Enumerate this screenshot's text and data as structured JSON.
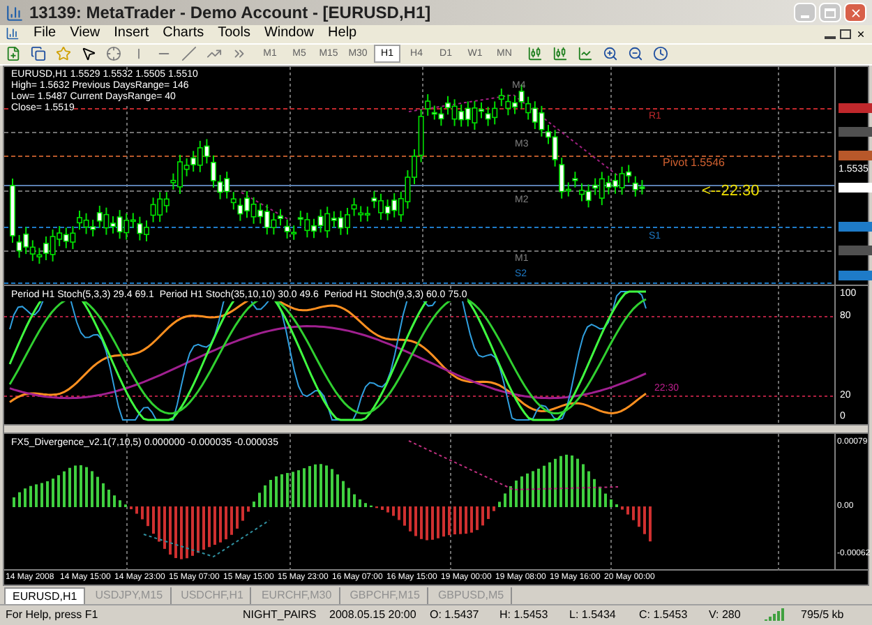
{
  "window": {
    "title": "13139: MetaTrader - Demo Account - [EURUSD,H1]"
  },
  "menu": [
    "File",
    "View",
    "Insert",
    "Charts",
    "Tools",
    "Window",
    "Help"
  ],
  "timeframes": [
    {
      "label": "M1",
      "selected": false
    },
    {
      "label": "M5",
      "selected": false
    },
    {
      "label": "M15",
      "selected": false
    },
    {
      "label": "M30",
      "selected": false
    },
    {
      "label": "H1",
      "selected": true
    },
    {
      "label": "H4",
      "selected": false
    },
    {
      "label": "D1",
      "selected": false
    },
    {
      "label": "W1",
      "selected": false
    },
    {
      "label": "MN",
      "selected": false
    }
  ],
  "main_chart": {
    "legend": [
      "EURUSD,H1  1.5529 1.5532 1.5505 1.5510",
      "High= 1.5632 Previous DaysRange= 146",
      "Low= 1.5487 Current DaysRange= 40",
      "Close= 1.5519"
    ],
    "levels": [
      {
        "label": "M4",
        "color": "#808080"
      },
      {
        "label": "R1",
        "color": "#c0282c"
      },
      {
        "label": "M3",
        "color": "#808080"
      },
      {
        "label": "M2",
        "color": "#808080"
      },
      {
        "label": "S1",
        "color": "#1e7bc8"
      },
      {
        "label": "M1",
        "color": "#808080"
      },
      {
        "label": "S2",
        "color": "#1e7bc8"
      }
    ],
    "pivot": "Pivot  1.5546",
    "countdown": "<--22:30",
    "price": "1.5535"
  },
  "stochastic": {
    "legend": [
      "Period H1 Stoch(5,3,3) 29.4 69.1",
      "Period H1 Stoch(35,10,10) 30.0 49.6",
      "Period H1 Stoch(9,3,3) 60.0 75.0"
    ],
    "axis": [
      "100",
      "80",
      "20",
      "0"
    ],
    "countdown": "22:30"
  },
  "divergence": {
    "legend": "FX5_Divergence_v2.1(7,10,5) 0.000000 -0.000035 -0.000035",
    "axis": [
      "0.00079",
      "0.00",
      "-0.00062"
    ]
  },
  "time_axis": [
    "14 May 2008",
    "14 May 15:00",
    "14 May 23:00",
    "15 May 07:00",
    "15 May 15:00",
    "15 May 23:00",
    "16 May 07:00",
    "16 May 15:00",
    "19 May 00:00",
    "19 May 08:00",
    "19 May 16:00",
    "20 May 00:00"
  ],
  "tabs": [
    {
      "label": "EURUSD,H1",
      "selected": true
    },
    {
      "label": "USDJPY,M15",
      "selected": false
    },
    {
      "label": "USDCHF,H1",
      "selected": false
    },
    {
      "label": "EURCHF,M30",
      "selected": false
    },
    {
      "label": "GBPCHF,M15",
      "selected": false
    },
    {
      "label": "GBPUSD,M5",
      "selected": false
    }
  ],
  "status_bar": [
    "For Help, press F1",
    "NIGHT_PAIRS",
    "2008.05.15 20:00",
    "O: 1.5437",
    "H: 1.5453",
    "L: 1.5434",
    "C: 1.5453",
    "V: 280",
    "795/5 kb"
  ]
}
